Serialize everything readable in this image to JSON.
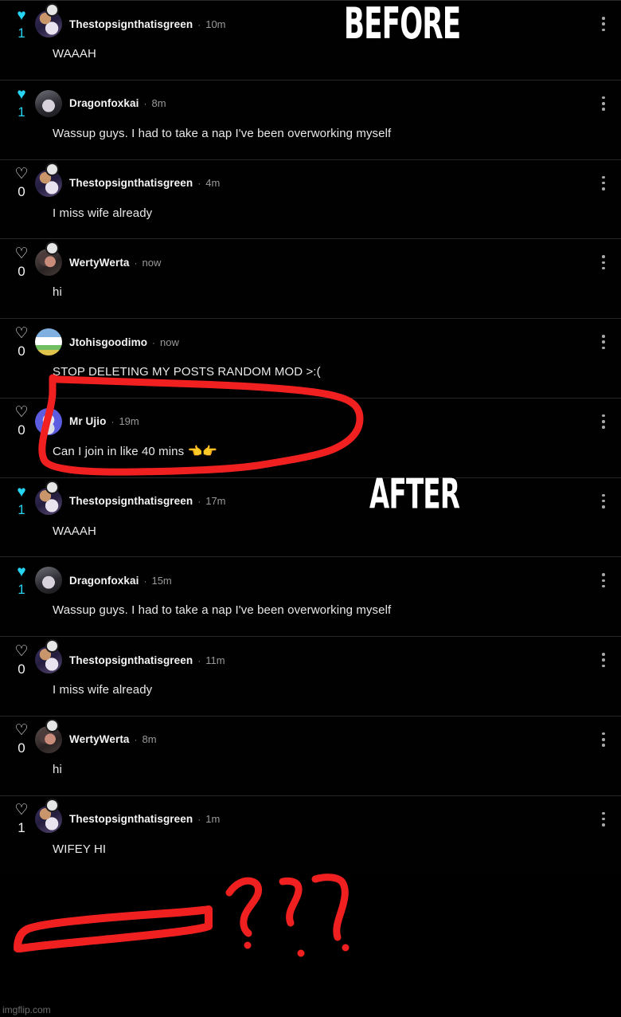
{
  "meme": {
    "label_before": "BEFORE",
    "label_after": "AFTER",
    "watermark": "imgflip.com",
    "annotation_color": "#f02020"
  },
  "icons": {
    "heart_filled": "♥",
    "heart_outline": "♡",
    "kebab": "more-options-vertical"
  },
  "comments": [
    {
      "id": "c1",
      "username": "Thestopsignthatisgreen",
      "time": "10m",
      "likes": "1",
      "liked": true,
      "text": "WAAAH",
      "avatar": "av-a",
      "status_dot": true
    },
    {
      "id": "c2",
      "username": "Dragonfoxkai",
      "time": "8m",
      "likes": "1",
      "liked": true,
      "text": "Wassup guys. I had to take a nap I've been overworking myself",
      "avatar": "av-b",
      "status_dot": false
    },
    {
      "id": "c3",
      "username": "Thestopsignthatisgreen",
      "time": "4m",
      "likes": "0",
      "liked": false,
      "text": "I miss wife already",
      "avatar": "av-a",
      "status_dot": true
    },
    {
      "id": "c4",
      "username": "WertyWerta",
      "time": "now",
      "likes": "0",
      "liked": false,
      "text": "hi",
      "avatar": "av-c",
      "status_dot": true
    },
    {
      "id": "c5",
      "username": "Jtohisgoodimo",
      "time": "now",
      "likes": "0",
      "liked": false,
      "text": "STOP DELETING MY POSTS RANDOM MOD >:(",
      "avatar": "av-d",
      "status_dot": false
    },
    {
      "id": "c6",
      "username": "Mr Ujio",
      "time": "19m",
      "likes": "0",
      "liked": false,
      "text": "Can I join in like 40 mins 👈👉",
      "avatar": "av-e",
      "status_dot": false
    },
    {
      "id": "c7",
      "username": "Thestopsignthatisgreen",
      "time": "17m",
      "likes": "1",
      "liked": true,
      "text": "WAAAH",
      "avatar": "av-a",
      "status_dot": true
    },
    {
      "id": "c8",
      "username": "Dragonfoxkai",
      "time": "15m",
      "likes": "1",
      "liked": true,
      "text": "Wassup guys. I had to take a nap I've been overworking myself",
      "avatar": "av-b",
      "status_dot": false
    },
    {
      "id": "c9",
      "username": "Thestopsignthatisgreen",
      "time": "11m",
      "likes": "0",
      "liked": false,
      "text": "I miss wife already",
      "avatar": "av-a",
      "status_dot": true
    },
    {
      "id": "c10",
      "username": "WertyWerta",
      "time": "8m",
      "likes": "0",
      "liked": false,
      "text": "hi",
      "avatar": "av-c",
      "status_dot": true
    },
    {
      "id": "c11",
      "username": "Thestopsignthatisgreen",
      "time": "1m",
      "likes": "1",
      "liked": false,
      "text": "WIFEY HI",
      "avatar": "av-a",
      "status_dot": true
    }
  ]
}
